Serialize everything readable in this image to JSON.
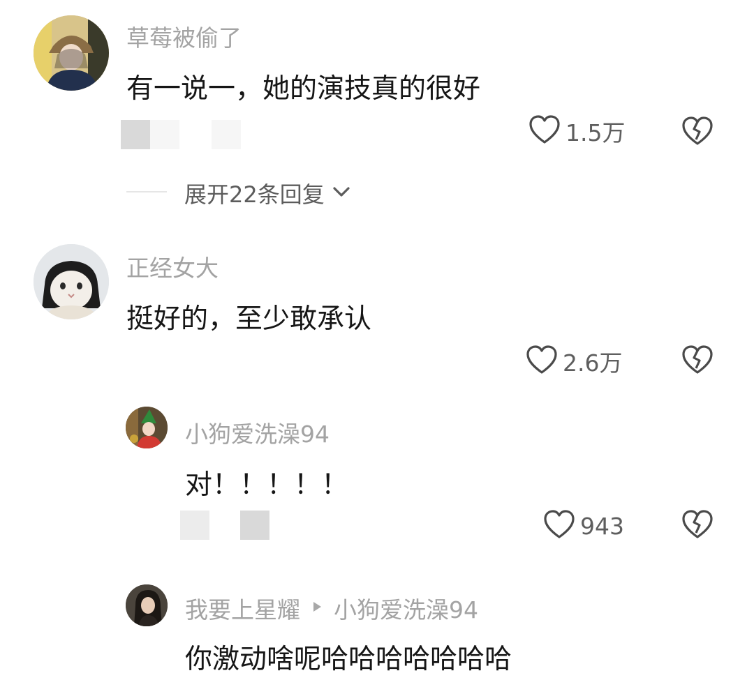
{
  "comments": [
    {
      "username": "草莓被偷了",
      "text": "有一说一，她的演技真的很好",
      "likes": "1.5万",
      "expand_replies": "展开22条回复"
    },
    {
      "username": "正经女大",
      "text": "挺好的，至少敢承认",
      "likes": "2.6万",
      "replies": [
        {
          "username": "小狗爱洗澡94",
          "text": "对！！！！！",
          "likes": "943"
        },
        {
          "username": "我要上星耀",
          "reply_to": "小狗爱洗澡94",
          "text": "你激动啥呢哈哈哈哈哈哈哈"
        }
      ]
    }
  ],
  "icons": {
    "like": "heart-outline-icon",
    "dislike": "broken-heart-icon",
    "expand": "chevron-down-icon",
    "reply_to": "triangle-right-icon"
  },
  "colors": {
    "username": "#a3a3a3",
    "text": "#161616",
    "meta": "#5e5e5e"
  }
}
